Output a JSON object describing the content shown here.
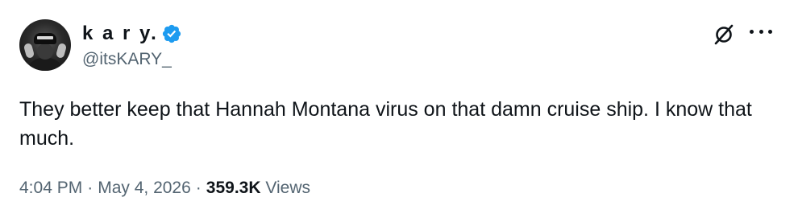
{
  "author": {
    "display_name": "k a r y.",
    "handle": "@itsKARY_",
    "verified": true,
    "avatar_icon": "avatar-photo"
  },
  "actions": {
    "grok_icon": "grok-icon",
    "more_icon": "more-icon"
  },
  "tweet": {
    "text": "They better keep that Hannah Montana virus on that damn cruise ship. I know that much."
  },
  "meta": {
    "time": "4:04 PM",
    "separator": "·",
    "date": "May 4, 2026",
    "views_count": "359.3K",
    "views_label": "Views"
  },
  "colors": {
    "verified_blue": "#1d9bf0",
    "secondary_text": "#536471",
    "primary_text": "#0f1419"
  }
}
